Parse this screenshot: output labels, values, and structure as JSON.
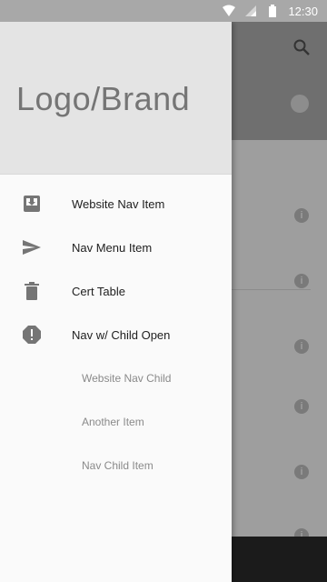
{
  "status_bar": {
    "time": "12:30",
    "icons": [
      "wifi-icon",
      "signal-icon",
      "battery-icon"
    ]
  },
  "drawer": {
    "brand": "Logo/Brand",
    "items": [
      {
        "label": "Website Nav Item",
        "icon": "inbox-icon"
      },
      {
        "label": "Nav Menu Item",
        "icon": "send-icon"
      },
      {
        "label": "Cert Table",
        "icon": "trash-icon"
      },
      {
        "label": "Nav w/ Child Open",
        "icon": "alert-octagon-icon"
      }
    ],
    "children": [
      {
        "label": "Website Nav Child"
      },
      {
        "label": "Another Item"
      },
      {
        "label": "Nav Child Item"
      }
    ]
  },
  "background": {
    "toolbar_action": "search-icon",
    "info_glyph": "i"
  },
  "colors": {
    "drawer": "#fafafa",
    "header": "#e4e4e4",
    "scrim": "#9e9e9e"
  }
}
